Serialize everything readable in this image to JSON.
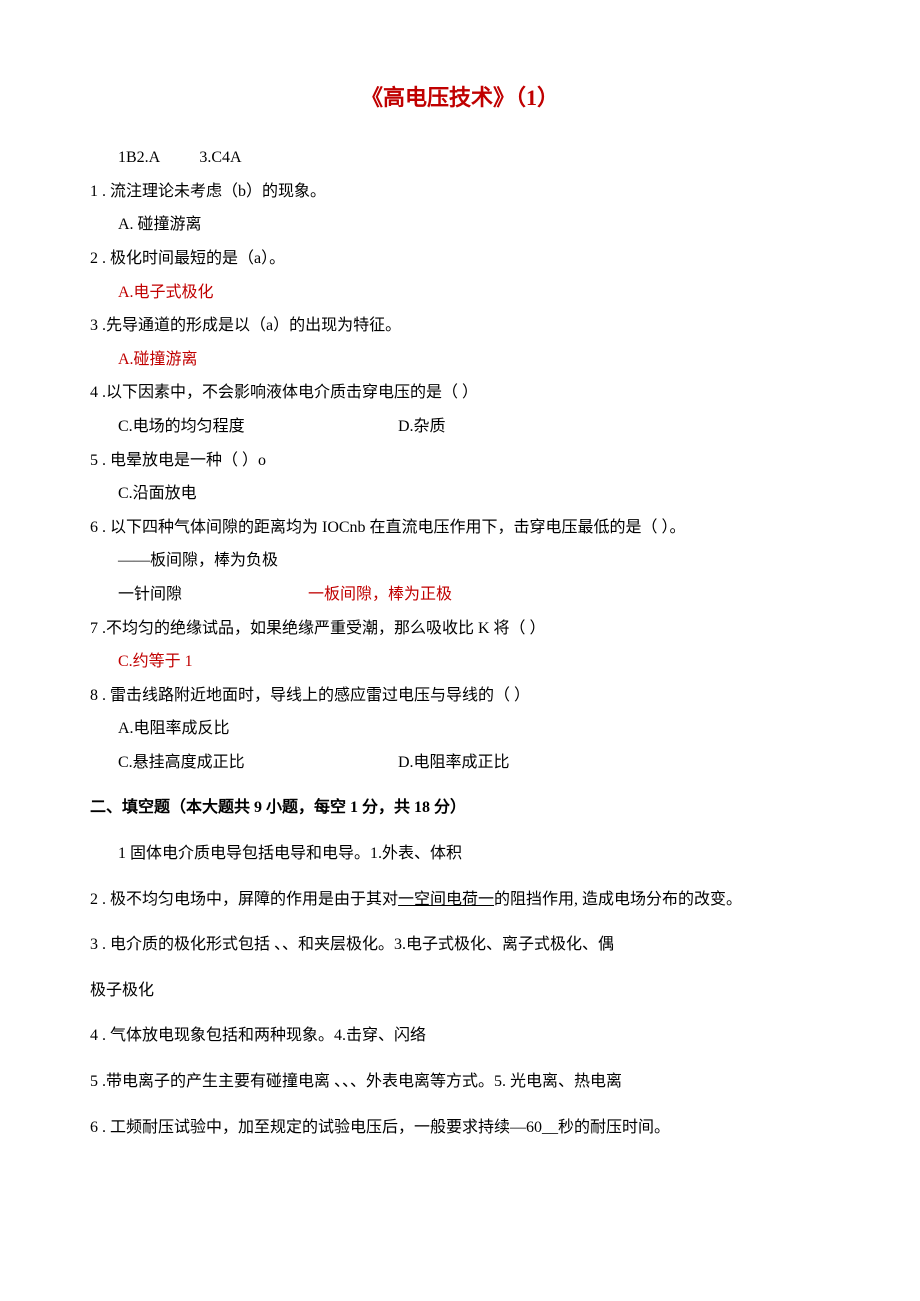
{
  "title": "《高电压技术》（1）",
  "header_line": "1B2.A          3.C4A",
  "q1": {
    "num": "1",
    "text": " . 流注理论未考虑（b）的现象。",
    "opt_a": "A. 碰撞游离"
  },
  "q2": {
    "num": "2",
    "text": " . 极化时间最短的是（a）。",
    "opt_a": "A.电子式极化"
  },
  "q3": {
    "num": "3",
    "text": " .先导通道的形成是以（a）的出现为特征。",
    "opt_a": "A.碰撞游离"
  },
  "q4": {
    "num": "4",
    "text": " .以下因素中，不会影响液体电介质击穿电压的是（    ）",
    "opt_c": "C.电场的均匀程度",
    "opt_d": "D.杂质"
  },
  "q5": {
    "num": "5",
    "text": " . 电晕放电是一种（    ）o",
    "opt_c": "C.沿面放电"
  },
  "q6": {
    "num": "6",
    "text": " . 以下四种气体间隙的距离均为 IOCnb 在直流电压作用下，击穿电压最低的是（     ）。",
    "opt_line1": "——板间隙，棒为负极",
    "opt_left": "一针间隙",
    "opt_right": "一板间隙，棒为正极"
  },
  "q7": {
    "num": "7",
    "text": " .不均匀的绝缘试品，如果绝缘严重受潮，那么吸收比 K 将（    ）",
    "opt_c": "C.约等于 1"
  },
  "q8": {
    "num": "8",
    "text": " . 雷击线路附近地面时，导线上的感应雷过电压与导线的（     ）",
    "opt_a": "A.电阻率成反比",
    "opt_c": "C.悬挂高度成正比",
    "opt_d": "D.电阻率成正比"
  },
  "section2_header": "二、填空题（本大题共 9 小题，每空 1 分，共 18 分）",
  "f1": "1 固体电介质电导包括电导和电导。1.外表、体积",
  "f2_num": "2",
  "f2_before": " . 极不均匀电场中，屏障的作用是由于其对",
  "f2_underline": "一空间电荷一",
  "f2_after": "的阻挡作用, 造成电场分布的改变。",
  "f3": {
    "num": "3",
    "text": " . 电介质的极化形式包括 、、和夹层极化。3.电子式极化、离子式极化、偶"
  },
  "f3_cont": "极子极化",
  "f4": {
    "num": "4",
    "text": " . 气体放电现象包括和两种现象。4.击穿、闪络"
  },
  "f5": {
    "num": "5",
    "text": " .带电离子的产生主要有碰撞电离 、、、外表电离等方式。5. 光电离、热电离"
  },
  "f6": {
    "num": "6",
    "text": " . 工频耐压试验中，加至规定的试验电压后，一般要求持续―60__秒的耐压时间。"
  }
}
